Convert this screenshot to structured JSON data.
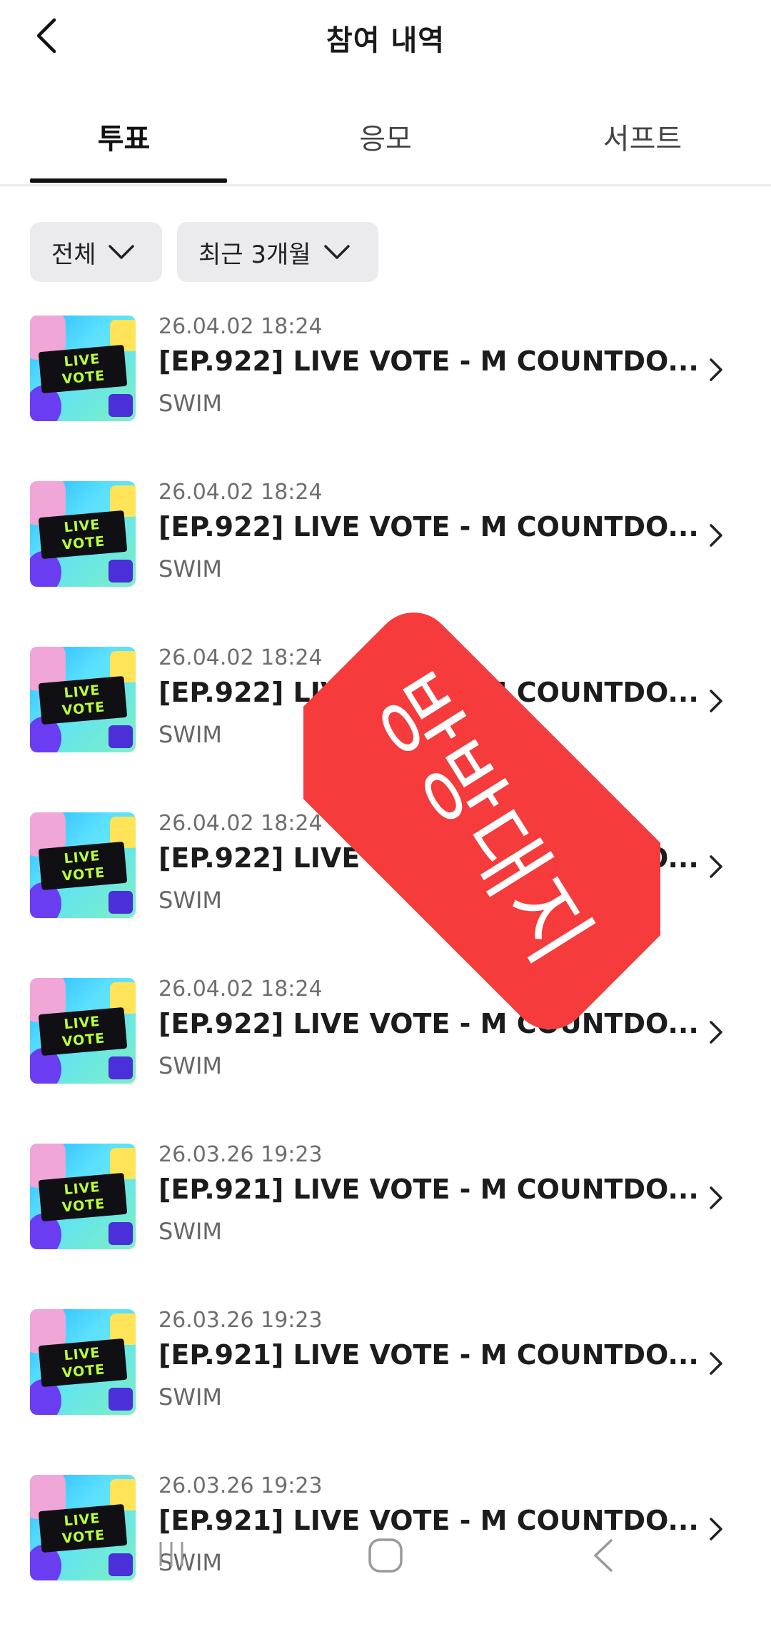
{
  "header": {
    "title": "참여 내역",
    "back_icon": "chevron-left-icon"
  },
  "tabs": [
    {
      "label": "투표",
      "active": true
    },
    {
      "label": "응모",
      "active": false
    },
    {
      "label": "서프트",
      "active": false
    }
  ],
  "filters": [
    {
      "label": "전체",
      "icon": "chevron-down-icon"
    },
    {
      "label": "최근 3개월",
      "icon": "chevron-down-icon"
    }
  ],
  "thumbnail": {
    "line1": "LIVE",
    "line2": "VOTE"
  },
  "items": [
    {
      "date": "26.04.02 18:24",
      "title": "[EP.922] LIVE VOTE - M COUNTDO...",
      "artist": "SWIM"
    },
    {
      "date": "26.04.02 18:24",
      "title": "[EP.922] LIVE VOTE - M COUNTDO...",
      "artist": "SWIM"
    },
    {
      "date": "26.04.02 18:24",
      "title": "[EP.922] LIVE VOTE - M COUNTDO...",
      "artist": "SWIM"
    },
    {
      "date": "26.04.02 18:24",
      "title": "[EP.922] LIVE VOTE - M COUNTDO...",
      "artist": "SWIM"
    },
    {
      "date": "26.04.02 18:24",
      "title": "[EP.922] LIVE VOTE - M COUNTDO...",
      "artist": "SWIM"
    },
    {
      "date": "26.03.26 19:23",
      "title": "[EP.921] LIVE VOTE - M COUNTDO...",
      "artist": "SWIM"
    },
    {
      "date": "26.03.26 19:23",
      "title": "[EP.921] LIVE VOTE - M COUNTDO...",
      "artist": "SWIM"
    },
    {
      "date": "26.03.26 19:23",
      "title": "[EP.921] LIVE VOTE - M COUNTDO...",
      "artist": "SWIM"
    }
  ],
  "stamp": {
    "text": "방방대지",
    "color": "#f53b3b"
  },
  "system_nav": {
    "recents_icon": "recents-icon",
    "home_icon": "home-icon",
    "back_icon": "back-icon"
  }
}
